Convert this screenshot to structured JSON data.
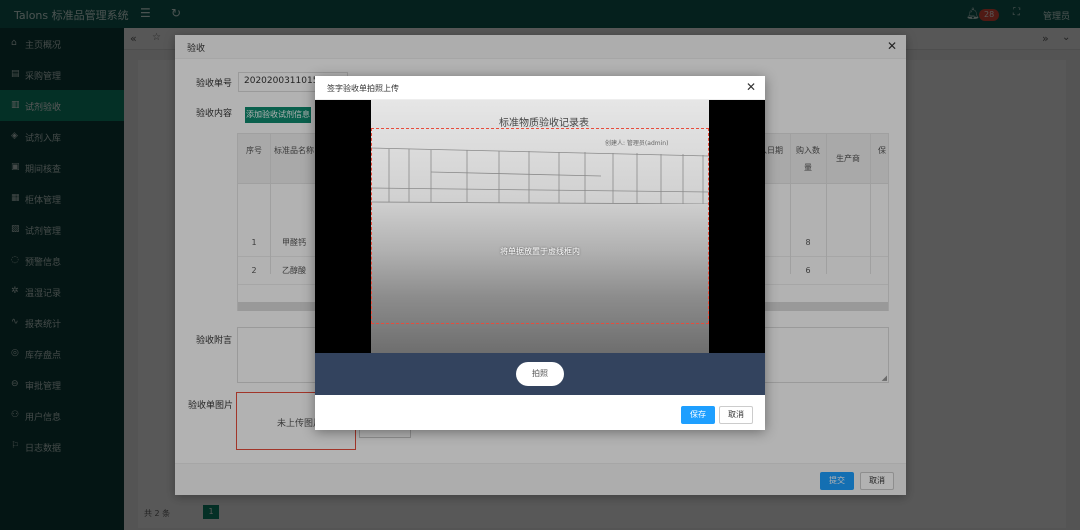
{
  "app": {
    "brand": "Talons 标准品管理系统",
    "badge_count": "28",
    "user": "管理员"
  },
  "sidebar": {
    "items": [
      {
        "label": "主页概况"
      },
      {
        "label": "采购管理"
      },
      {
        "label": "试剂验收"
      },
      {
        "label": "试剂入库"
      },
      {
        "label": "期间核查"
      },
      {
        "label": "柜体管理"
      },
      {
        "label": "试剂管理"
      },
      {
        "label": "预警信息"
      },
      {
        "label": "温湿记录"
      },
      {
        "label": "报表统计"
      },
      {
        "label": "库存盘点"
      },
      {
        "label": "审批管理"
      },
      {
        "label": "用户信息"
      },
      {
        "label": "日志数据"
      }
    ]
  },
  "pager": {
    "total": "共 2 条",
    "current": "1"
  },
  "outer_dialog": {
    "title": "验收",
    "order_label": "验收单号",
    "order_value": "20202003110157027",
    "content_label": "验收内容",
    "add_btn": "添加验收试剂信息",
    "table": {
      "headers": {
        "seq": "序号",
        "name": "标准品名称",
        "date": "入日期",
        "qty": "购入数量",
        "maker": "生产商",
        "keep": "保"
      },
      "rows": [
        {
          "seq": "1",
          "name": "甲醛钙",
          "qty": "8"
        },
        {
          "seq": "2",
          "name": "乙醇酸",
          "qty": "6"
        }
      ]
    },
    "remark_label": "验收附言",
    "image_label": "验收单图片",
    "image_placeholder": "未上传图片",
    "submit_btn": "提交",
    "cancel_btn": "取消"
  },
  "camera_dialog": {
    "title": "签字验收单拍照上传",
    "paper_title": "标准物质验收记录表",
    "paper_sub": "创建人: 管理员(admin)",
    "guide_text": "将单据放置于虚线框内",
    "shutter_btn": "拍照",
    "save_btn": "保存",
    "cancel_btn": "取消"
  }
}
